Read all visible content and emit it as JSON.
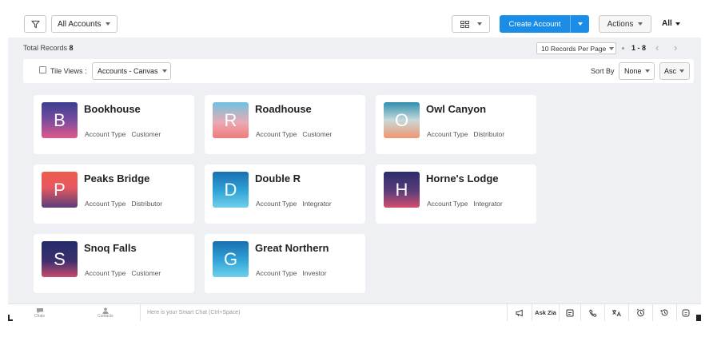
{
  "toolbar": {
    "account_view": "All Accounts",
    "create_label": "Create Account",
    "actions_label": "Actions",
    "all_label": "All"
  },
  "records": {
    "total_label": "Total Records",
    "total_count": "8",
    "per_page": "10 Records Per Page",
    "range": "1 - 8",
    "prev": "‹",
    "next": "›"
  },
  "viewbar": {
    "tile_views_label": "Tile Views :",
    "canvas_view": "Accounts - Canvas",
    "sort_by_label": "Sort By",
    "sort_field": "None",
    "sort_order": "Asc"
  },
  "meta_key": "Account Type",
  "cards": [
    {
      "initial": "B",
      "name": "Bookhouse",
      "type": "Customer"
    },
    {
      "initial": "R",
      "name": "Roadhouse",
      "type": "Customer"
    },
    {
      "initial": "O",
      "name": "Owl Canyon",
      "type": "Distributor"
    },
    {
      "initial": "P",
      "name": "Peaks Bridge",
      "type": "Distributor"
    },
    {
      "initial": "D",
      "name": "Double R",
      "type": "Integrator"
    },
    {
      "initial": "H",
      "name": "Horne's Lodge",
      "type": "Integrator"
    },
    {
      "initial": "S",
      "name": "Snoq Falls",
      "type": "Customer"
    },
    {
      "initial": "G",
      "name": "Great Northern",
      "type": "Investor"
    }
  ],
  "bottombar": {
    "chats": "Chats",
    "contacts": "Contacts",
    "smart_chat_placeholder": "Here is your Smart Chat (Ctrl+Space)",
    "ask_zia": "Ask Zia"
  },
  "icons": [
    "filter-icon",
    "grid-view-icon",
    "caret-down-icon",
    "checkbox-icon",
    "chat-bubble-icon",
    "contacts-icon",
    "megaphone-icon",
    "notes-icon",
    "phone-icon",
    "translate-icon",
    "alarm-icon",
    "history-icon",
    "help-icon"
  ],
  "colors": {
    "primary": "#1a8de8",
    "canvas_bg": "#eef0f3"
  }
}
